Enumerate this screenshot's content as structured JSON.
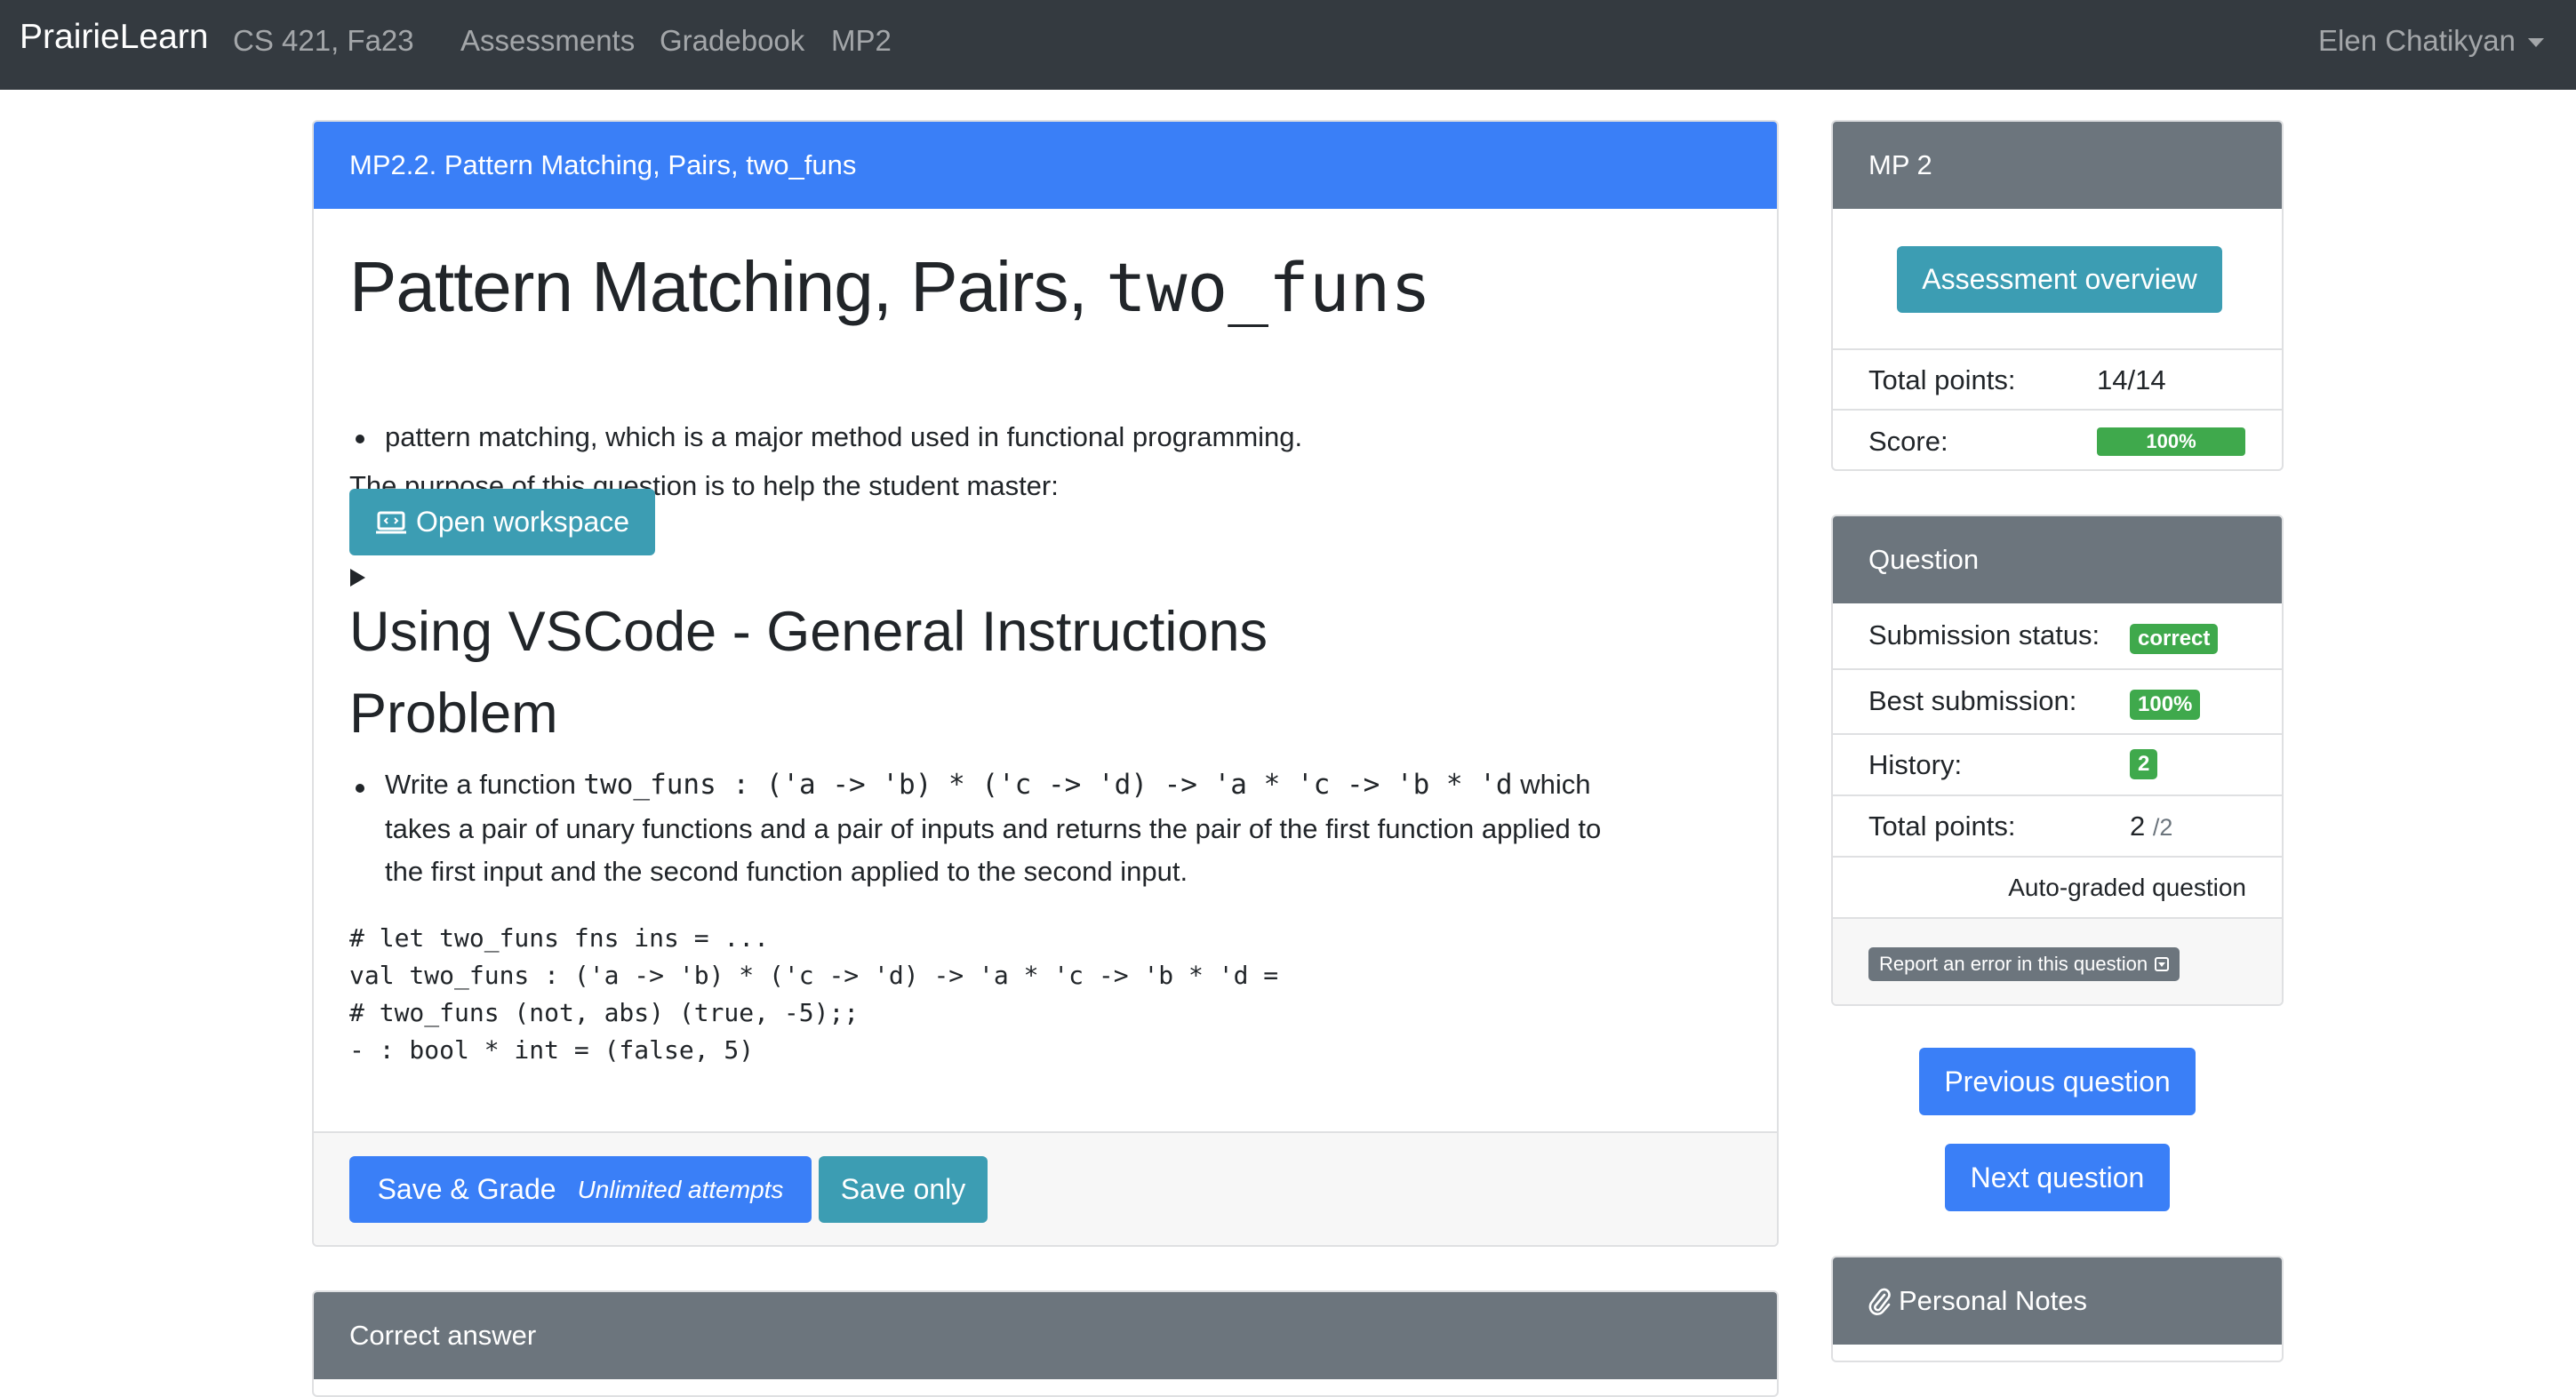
{
  "nav": {
    "brand": "PrairieLearn",
    "course": "CS 421, Fa23",
    "links": [
      "Assessments",
      "Gradebook",
      "MP2"
    ],
    "user": "Elen Chatikyan"
  },
  "question_card": {
    "header": "MP2.2. Pattern Matching, Pairs, two_funs",
    "title_text": "Pattern Matching, Pairs, ",
    "title_code": "two_funs",
    "purpose": "The purpose of this question is to help the student master:",
    "bullet": "pattern matching, which is a major method used in functional programming.",
    "open_workspace": "Open workspace",
    "heading_vscode": "Using VSCode - General Instructions",
    "heading_problem": "Problem",
    "problem_prefix": "Write a function ",
    "problem_signature": "two_funs : ('a -> 'b) * ('c -> 'd) -> 'a * 'c -> 'b * 'd",
    "problem_suffix": " which",
    "problem_line2": "takes a pair of unary functions and a pair of inputs and returns the pair of the first function applied to",
    "problem_line3": "the first input and the second function applied to the second input.",
    "code_lines": [
      "# let two_funs fns ins = ...",
      "val two_funs : ('a -> 'b) * ('c -> 'd) -> 'a * 'c -> 'b * 'd =",
      "# two_funs (not, abs) (true, -5);;",
      "- : bool * int = (false, 5)"
    ],
    "save_grade": "Save & Grade",
    "unlimited": "Unlimited attempts",
    "save_only": "Save only"
  },
  "correct_answer_card": {
    "header": "Correct answer"
  },
  "assessment_card": {
    "header": "MP 2",
    "overview_button": "Assessment overview",
    "total_points_label": "Total points:",
    "total_points_value": "14/14",
    "score_label": "Score:",
    "score_value": "100%",
    "score_fraction": 1.0
  },
  "question_info_card": {
    "header": "Question",
    "submission_status_label": "Submission status:",
    "submission_status_value": "correct",
    "best_submission_label": "Best submission:",
    "best_submission_value": "100%",
    "history_label": "History:",
    "history_value": "2",
    "total_points_label": "Total points:",
    "total_points_value": "2",
    "total_points_max": "/2",
    "auto_graded": "Auto-graded question",
    "report_error": "Report an error in this question"
  },
  "nav_buttons": {
    "previous": "Previous question",
    "next": "Next question"
  },
  "notes_card": {
    "header": "Personal Notes"
  },
  "colors": {
    "primary": "#3a7ff7",
    "info": "#3c9db3",
    "success": "#3fa94c",
    "secondary": "#6c757d",
    "navbar": "#343a40"
  }
}
